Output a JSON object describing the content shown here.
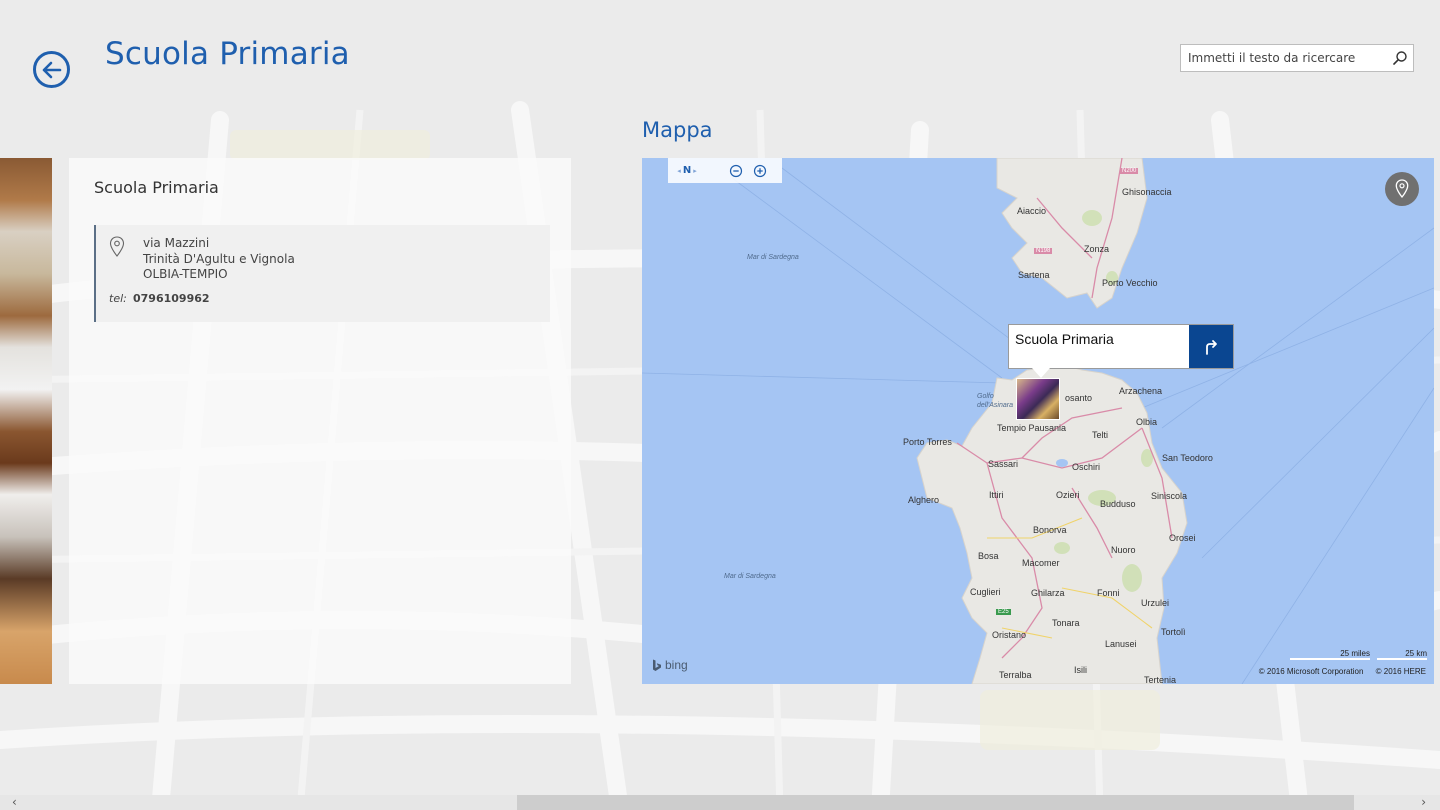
{
  "header": {
    "title": "Scuola Primaria",
    "search_placeholder": "Immetti il testo da ricercare"
  },
  "details": {
    "title": "Scuola Primaria",
    "address": {
      "street": "via Mazzini",
      "city": "Trinità D'Agultu e Vignola",
      "province": "OLBIA-TEMPIO"
    },
    "tel_label": "tel:",
    "tel_value": "0796109962"
  },
  "map": {
    "section_title": "Mappa",
    "compass_label": "N",
    "callout_title": "Scuola Primaria",
    "sea_labels": [
      "Mar di Sardegna",
      "Mar di Sardegna"
    ],
    "gulf_label": "Golfo dell'Asinara",
    "places": [
      "Ghisonaccia",
      "Aiaccio",
      "Zonza",
      "Sartena",
      "Porto Vecchio",
      "Arzachena",
      "Olbia",
      "Tempio Pausania",
      "Telti",
      "Porto Torres",
      "Sassari",
      "Oschiri",
      "San Teodoro",
      "Alghero",
      "Ittiri",
      "Ozieri",
      "Siniscola",
      "Budduso",
      "Bonorva",
      "Orosei",
      "Bosa",
      "Nuoro",
      "Macomer",
      "Cuglieri",
      "Ghilarza",
      "Fonni",
      "Urzulei",
      "Oristano",
      "Tonara",
      "Tortolì",
      "Lanusei",
      "Terralba",
      "Isili",
      "Tertenia",
      "osanto"
    ],
    "road_labels": [
      "N200",
      "N198",
      "E25"
    ],
    "scale_miles": "25 miles",
    "scale_km": "25 km",
    "brand": "bing",
    "copyright_ms": "© 2016 Microsoft Corporation",
    "copyright_here": "© 2016 HERE",
    "colors": {
      "water": "#a5c5f3",
      "land": "#e9e8e4",
      "accent": "#1f5fae",
      "callout_button": "#0a4691"
    }
  },
  "icons": {
    "back": "back-arrow-icon",
    "search": "search-icon",
    "pin": "location-pin-icon",
    "zoom_out": "zoom-out-icon",
    "zoom_in": "zoom-in-icon",
    "locate": "locate-me-icon",
    "directions": "directions-icon"
  }
}
